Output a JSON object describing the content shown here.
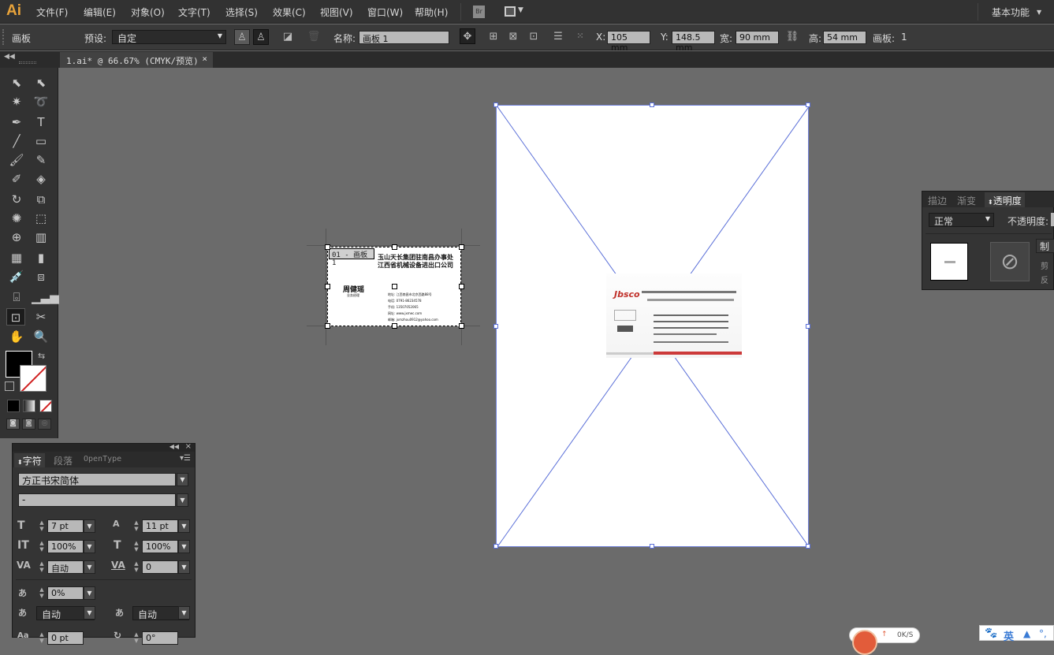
{
  "app": {
    "logo": "Ai"
  },
  "menubar": {
    "items": [
      "文件(F)",
      "编辑(E)",
      "对象(O)",
      "文字(T)",
      "选择(S)",
      "效果(C)",
      "视图(V)",
      "窗口(W)",
      "帮助(H)"
    ],
    "bridge_icon": "Br",
    "workspace": "基本功能"
  },
  "control_bar": {
    "mode_label": "画板",
    "preset_label": "预设:",
    "preset_value": "自定",
    "name_label": "名称:",
    "name_value": "画板 1",
    "x_label": "X:",
    "x_value": "105 mm",
    "y_label": "Y:",
    "y_value": "148.5 mm",
    "w_label": "宽:",
    "w_value": "90 mm",
    "h_label": "高:",
    "h_value": "54 mm",
    "artboards_label": "画板:",
    "artboards_value": "1"
  },
  "document": {
    "tab_label": "1.ai* @ 66.67% (CMYK/预览)",
    "close": "×"
  },
  "artboard_card": {
    "label": "01 - 画板 1",
    "company_line1": "玉山天长集团驻南昌办事处",
    "company_line2": "江西省机械设备进出口公司",
    "person": "周健瑶",
    "title": "业务经理",
    "details": [
      "地址: 江西南昌市北京西路88号",
      "电话: 0791-86234578",
      "手机: 13507052065",
      "网址: www.jxmec.com",
      "邮箱: jxmzhou0912@yahoo.com"
    ]
  },
  "character_panel": {
    "tabs": [
      "字符",
      "段落",
      "OpenType"
    ],
    "font_family": "方正书宋简体",
    "font_style": "-",
    "font_size": "7 pt",
    "leading": "11 pt",
    "vertical_scale": "100%",
    "horizontal_scale": "100%",
    "kerning": "自动",
    "tracking": "0",
    "tsume": "0%",
    "aki_left": "自动",
    "aki_right": "自动",
    "baseline_shift": "0 pt",
    "rotation": "0°"
  },
  "transparency_panel": {
    "tabs": [
      "描边",
      "渐变",
      "透明度"
    ],
    "blend_mode": "正常",
    "opacity_label": "不透明度:",
    "make_mask_label": "制",
    "clip_label": "剪",
    "invert_label": "反"
  },
  "overlays": {
    "speed_widget": "0K/S",
    "ime_label": "英"
  },
  "colors": {
    "accent": "#e8a33a",
    "selection": "#5a6fd8",
    "canvas": "#6b6b6b"
  }
}
